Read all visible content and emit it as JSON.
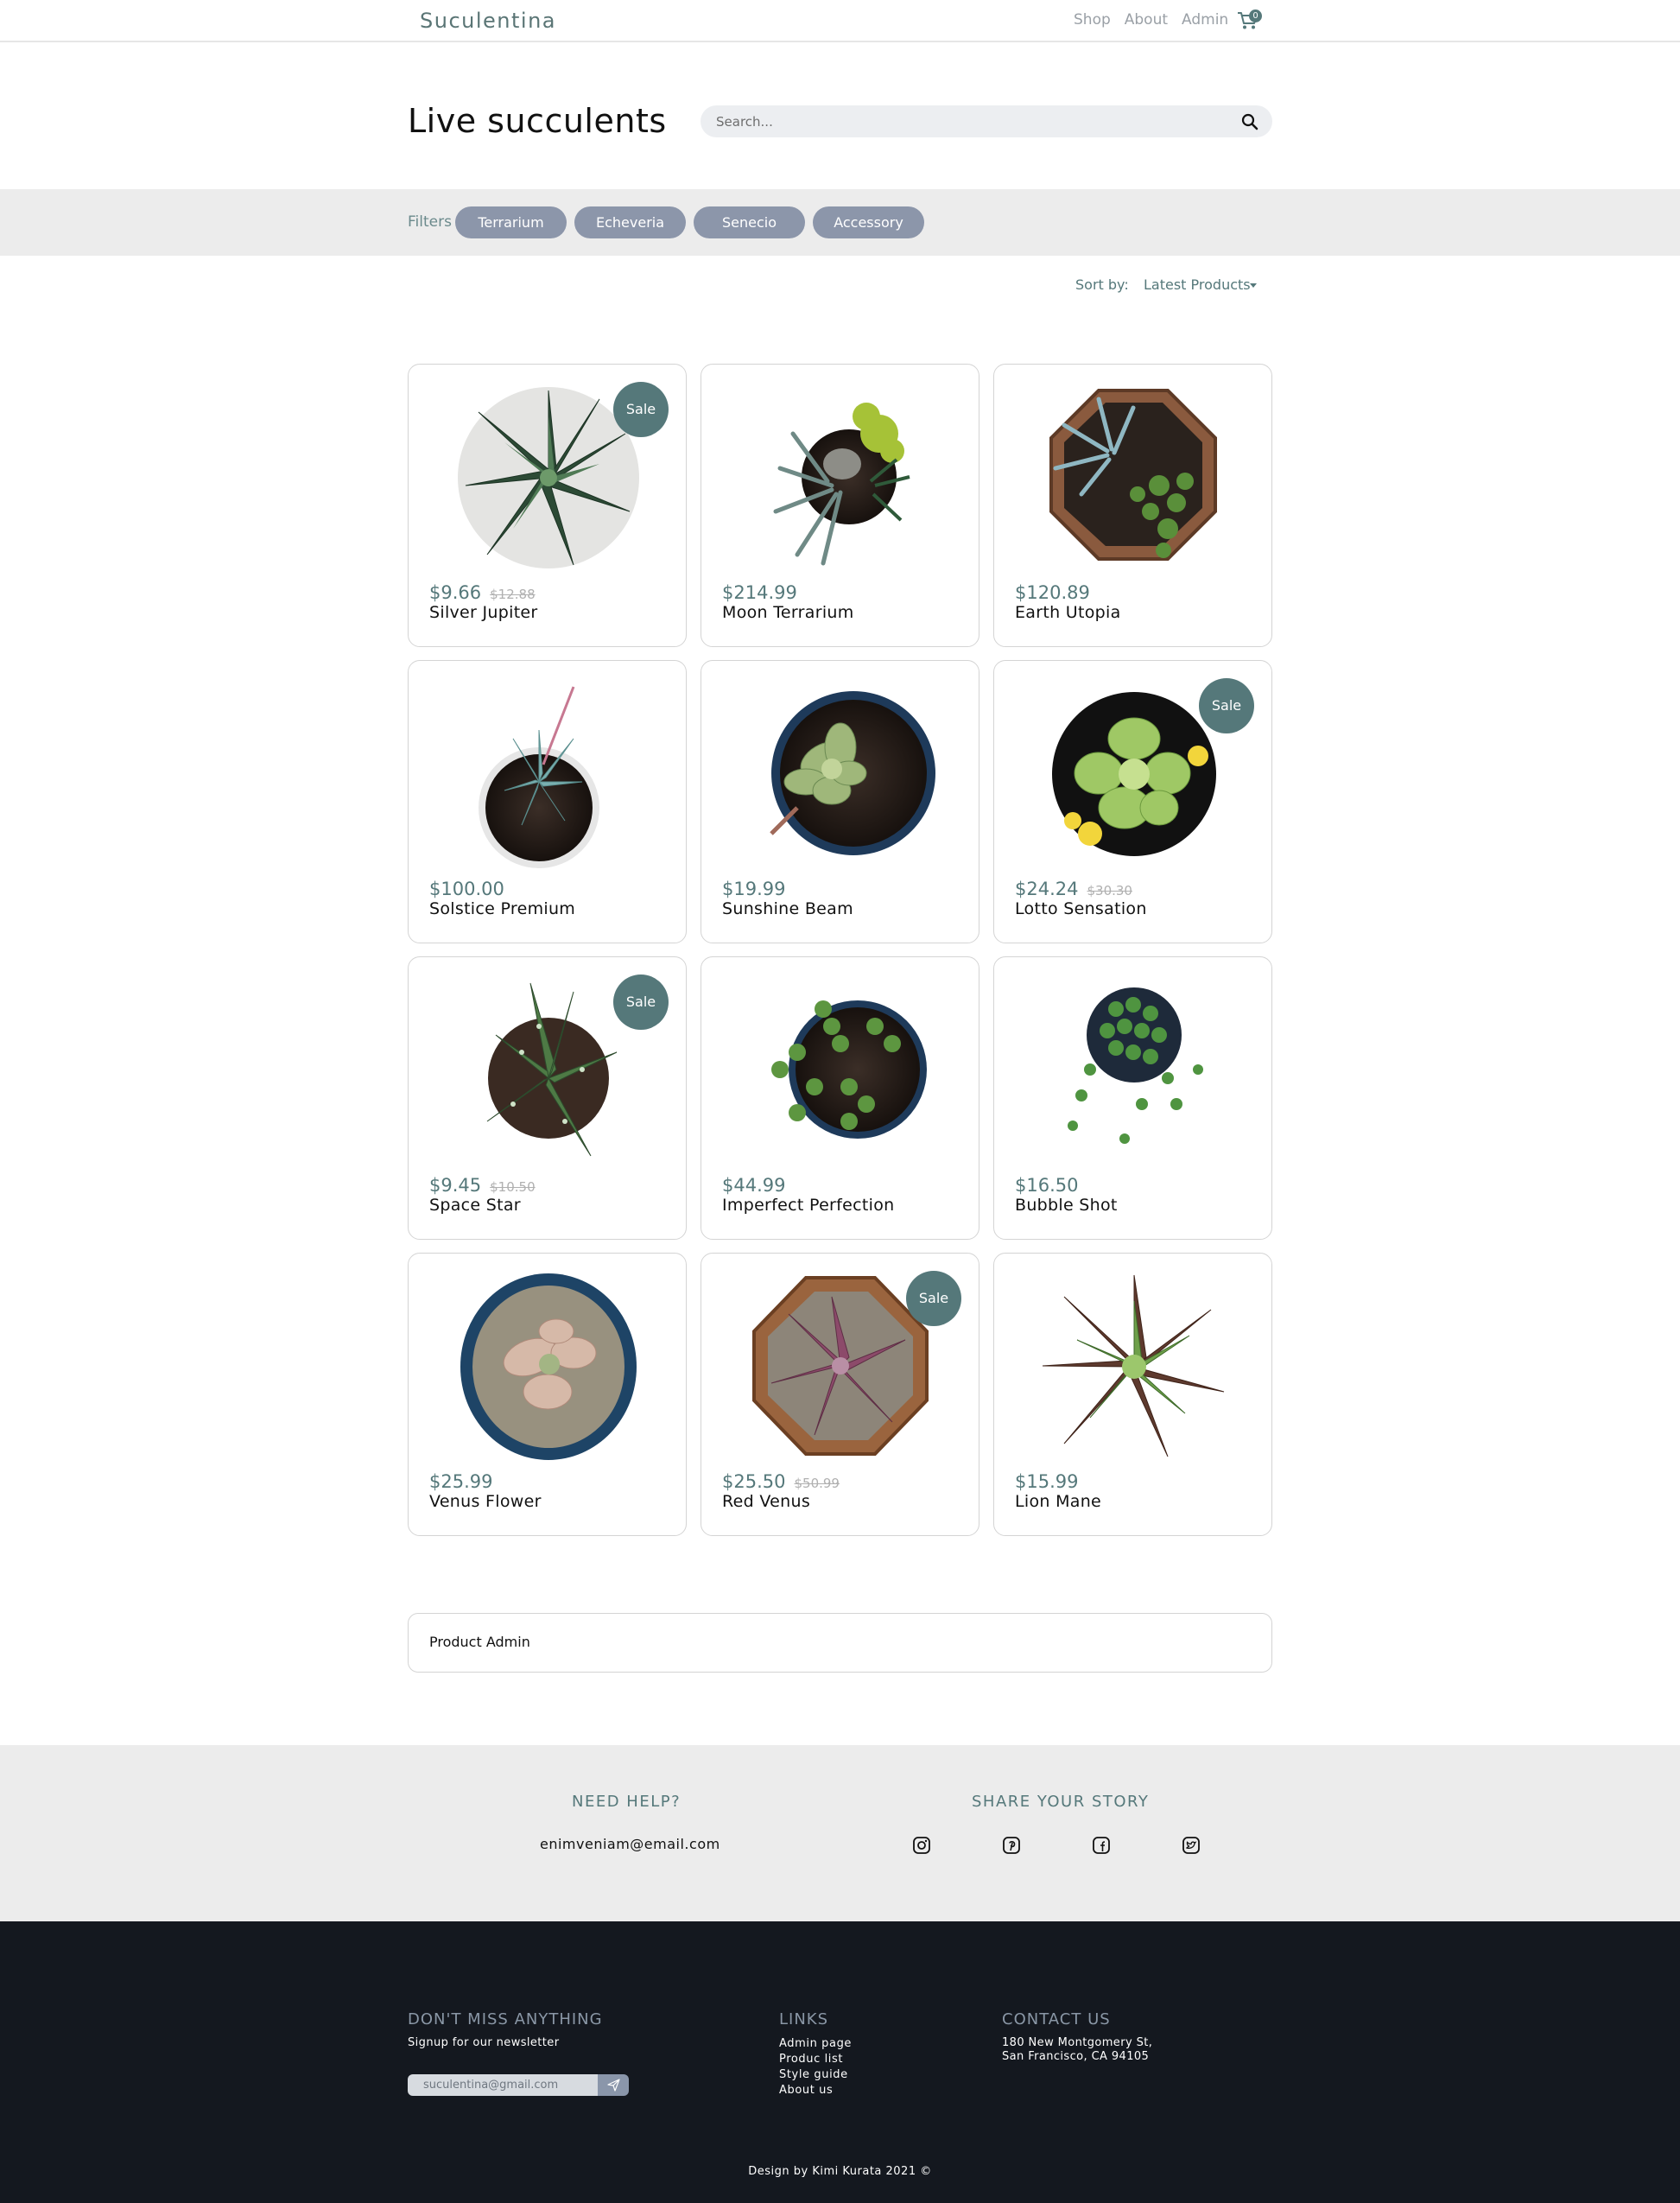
{
  "nav": {
    "logo": "Suculentina",
    "links": [
      "Shop",
      "About",
      "Admin"
    ],
    "cart_count": "0"
  },
  "header": {
    "title": "Live succulents",
    "search_placeholder": "Search..."
  },
  "filters": {
    "label": "Filters",
    "chips": [
      "Terrarium",
      "Echeveria",
      "Senecio",
      "Accessory"
    ]
  },
  "sort": {
    "label": "Sort by:",
    "value": "Latest Products"
  },
  "products": [
    {
      "name": "Silver Jupiter",
      "price": "$9.66",
      "old_price": "$12.88",
      "sale": "Sale"
    },
    {
      "name": "Moon Terrarium",
      "price": "$214.99",
      "old_price": "",
      "sale": ""
    },
    {
      "name": "Earth Utopia",
      "price": "$120.89",
      "old_price": "",
      "sale": ""
    },
    {
      "name": "Solstice Premium",
      "price": "$100.00",
      "old_price": "",
      "sale": ""
    },
    {
      "name": "Sunshine Beam",
      "price": "$19.99",
      "old_price": "",
      "sale": ""
    },
    {
      "name": "Lotto Sensation",
      "price": "$24.24",
      "old_price": "$30.30",
      "sale": "Sale"
    },
    {
      "name": "Space Star",
      "price": "$9.45",
      "old_price": "$10.50",
      "sale": "Sale"
    },
    {
      "name": "Imperfect Perfection",
      "price": "$44.99",
      "old_price": "",
      "sale": ""
    },
    {
      "name": "Bubble Shot",
      "price": "$16.50",
      "old_price": "",
      "sale": ""
    },
    {
      "name": "Venus Flower",
      "price": "$25.99",
      "old_price": "",
      "sale": ""
    },
    {
      "name": "Red Venus",
      "price": "$25.50",
      "old_price": "$50.99",
      "sale": "Sale"
    },
    {
      "name": "Lion Mane",
      "price": "$15.99",
      "old_price": "",
      "sale": ""
    }
  ],
  "admin": {
    "label": "Product Admin"
  },
  "help": {
    "need_help_title": "NEED HELP?",
    "email": "enimveniam@email.com",
    "share_title": "SHARE YOUR STORY",
    "social_icons": [
      "instagram-icon",
      "pinterest-icon",
      "facebook-icon",
      "twitter-icon"
    ]
  },
  "footer": {
    "newsletter_title": "DON'T MISS ANYTHING",
    "newsletter_text": "Signup for our newsletter",
    "newsletter_placeholder": "suculentina@gmail.com",
    "links_title": "LINKS",
    "links": [
      "Admin page",
      "Produc list",
      "Style guide",
      "About us"
    ],
    "contact_title": "CONTACT US",
    "address_line1": "180 New Montgomery St,",
    "address_line2": "San Francisco, CA 94105",
    "credit": "Design by Kimi Kurata 2021 ©"
  },
  "colors": {
    "accent": "#55787a",
    "chip": "#8c96aa",
    "footer_bg": "#14181f",
    "strip_bg": "#ececec"
  }
}
